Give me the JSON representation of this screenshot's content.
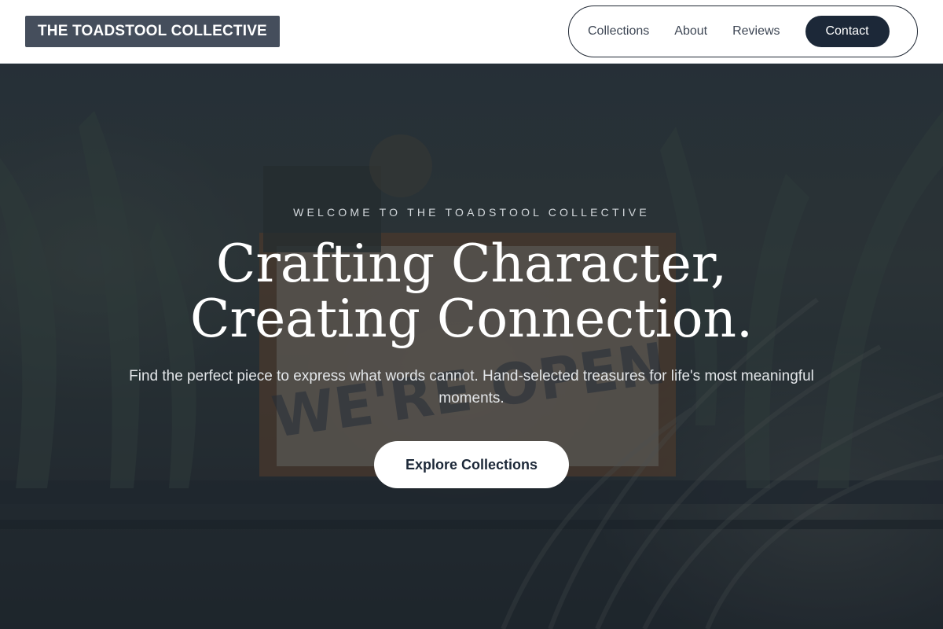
{
  "brand": {
    "name": "THE TOADSTOOL COLLECTIVE"
  },
  "nav": {
    "links": [
      "Collections",
      "About",
      "Reviews"
    ],
    "contact_label": "Contact"
  },
  "hero": {
    "eyebrow": "WELCOME TO THE TOADSTOOL COLLECTIVE",
    "headline_line1": "Crafting Character,",
    "headline_line2": "Creating Connection.",
    "subtext": "Find the perfect piece to express what words cannot. Hand-selected treasures for life's most meaningful moments.",
    "cta_label": "Explore Collections",
    "background_sign_text": "WE'RE OPEN"
  },
  "colors": {
    "logo_bg": "#454e5c",
    "nav_contact_bg": "#1c2838",
    "header_bg": "#ffffff",
    "hero_overlay": "#1c242c",
    "cta_bg": "#ffffff",
    "cta_text": "#1c2838"
  }
}
